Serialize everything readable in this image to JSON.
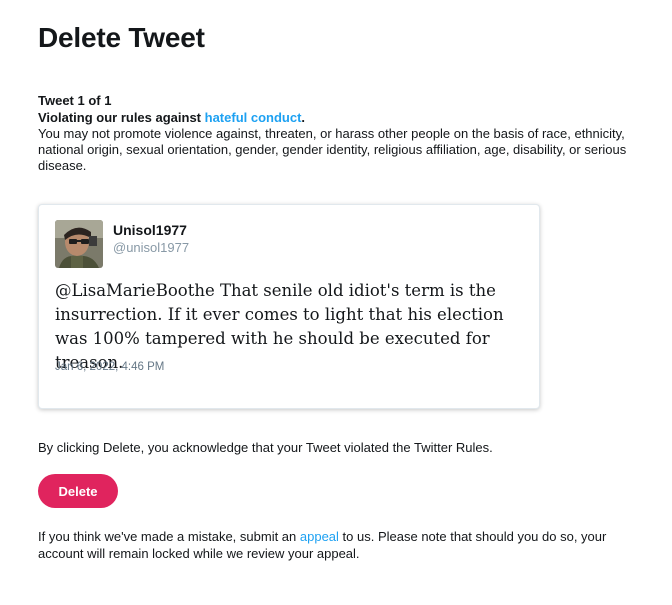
{
  "page": {
    "title": "Delete Tweet"
  },
  "violation": {
    "count_label": "Tweet 1 of 1",
    "rule_prefix": "Violating our rules against ",
    "rule_link": "hateful conduct",
    "rule_suffix": ".",
    "description": "You may not promote violence against, threaten, or harass other people on the basis of race, ethnicity, national origin, sexual orientation, gender, gender identity, religious affiliation, age, disability, or serious disease."
  },
  "tweet": {
    "display_name": "Unisol1977",
    "handle": "@unisol1977",
    "text": "@LisaMarieBoothe That senile old idiot's term is the insurrection. If it ever comes to light that his election was 100% tampered with he should be executed for treason.",
    "timestamp": "Jan 6, 2022, 4:46 PM",
    "avatar_icon": "user-avatar-photo"
  },
  "acknowledge": {
    "text": "By clicking Delete, you acknowledge that your Tweet violated the Twitter Rules."
  },
  "actions": {
    "delete_label": "Delete"
  },
  "appeal": {
    "prefix": "If you think we've made a mistake, submit an ",
    "link": "appeal",
    "suffix": " to us. Please note that should you do so, your account will remain locked while we review your appeal."
  },
  "colors": {
    "accent_link": "#1da1f2",
    "delete_button": "#e0245e",
    "text": "#14171a",
    "muted": "#8899a6"
  }
}
